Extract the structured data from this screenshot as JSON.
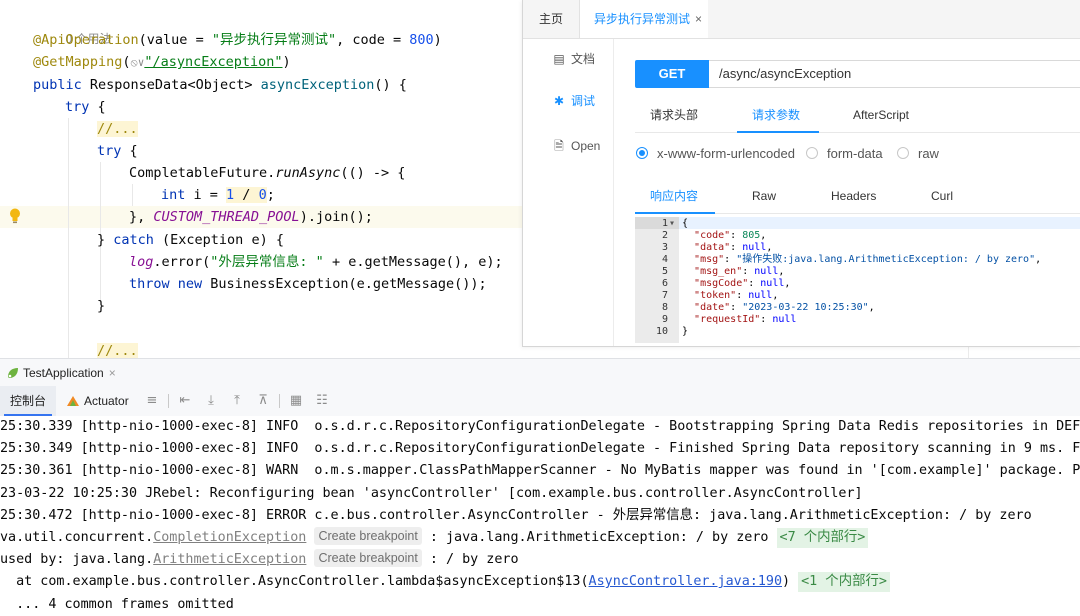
{
  "editor": {
    "usages": "0 个用法",
    "line_api_op": {
      "ann": "@ApiOperation",
      "p1": "(value = ",
      "str": "\"异步执行异常测试\"",
      "p2": ", code = ",
      "num": "800",
      "p3": ")"
    },
    "line_get_mapping": {
      "ann": "@GetMapping",
      "p1": "(",
      "icon": "⦸∨",
      "str": "\"/asyncException\"",
      "p2": ")"
    },
    "line_signature": {
      "kw": "public",
      "p1": " ResponseData<Object> ",
      "fn": "asyncException",
      "p2": "() {"
    },
    "line_try1": {
      "kw": "try",
      "p1": " {"
    },
    "line_fold1": "//...",
    "line_try2": {
      "kw": "try",
      "p1": " {"
    },
    "line_run_async": {
      "p1": "CompletableFuture.",
      "fn": "runAsync",
      "p2": "(() -> {"
    },
    "line_div": {
      "kw": "int",
      "p1": " i = ",
      "n1": "1",
      "p2": " / ",
      "n2": "0",
      "p3": ";"
    },
    "line_pool": {
      "p1": "}, ",
      "const": "CUSTOM_THREAD_POOL",
      "p2": ").join();"
    },
    "line_catch": {
      "p1": "} ",
      "kw": "catch",
      "p2": " (Exception e) {"
    },
    "line_log": {
      "field": "log",
      "p1": ".error(",
      "str": "\"外层异常信息: \"",
      "p2": " + e.getMessage(), e);"
    },
    "line_throw": {
      "kw1": "throw",
      "kw2": "new",
      "p1": " BusinessException(e.getMessage());"
    },
    "line_close": "}",
    "line_fold2": "//..."
  },
  "api_panel": {
    "tabs": {
      "home": "主页",
      "active": "异步执行异常测试",
      "close": "×"
    },
    "sidebar": [
      {
        "icon": "▤",
        "label": "文档"
      },
      {
        "icon": "✱",
        "label": "调试"
      },
      {
        "icon": "🗎",
        "label": "Open"
      }
    ],
    "method": "GET",
    "url": "/async/asyncException",
    "request_tabs": [
      "请求头部",
      "请求参数",
      "AfterScript"
    ],
    "active_request_tab": "请求参数",
    "body_types": [
      "x-www-form-urlencoded",
      "form-data",
      "raw"
    ],
    "selected_body_type": "x-www-form-urlencoded",
    "response_tabs": [
      "响应内容",
      "Raw",
      "Headers",
      "Curl"
    ],
    "active_response_tab": "响应内容",
    "response": {
      "line_numbers": [
        "1",
        "2",
        "3",
        "4",
        "5",
        "6",
        "7",
        "8",
        "9",
        "10"
      ],
      "fold_marker": "▾",
      "open_brace": "{",
      "close_brace": "}",
      "entries": [
        {
          "key": "\"code\"",
          "value": "805"
        },
        {
          "key": "\"data\"",
          "value": "null"
        },
        {
          "key": "\"msg\"",
          "value": "\"操作失败:java.lang.ArithmeticException: / by zero\""
        },
        {
          "key": "\"msg_en\"",
          "value": "null"
        },
        {
          "key": "\"msgCode\"",
          "value": "null"
        },
        {
          "key": "\"token\"",
          "value": "null"
        },
        {
          "key": "\"date\"",
          "value": "\"2023-03-22 10:25:30\""
        },
        {
          "key": "\"requestId\"",
          "value": "null"
        }
      ]
    }
  },
  "run_window": {
    "title": "TestApplication",
    "close": "×",
    "tabs": [
      "控制台",
      "Actuator"
    ],
    "toolbar_icons": [
      "menu-icon",
      "scroll-end-icon",
      "download-icon",
      "upload-icon",
      "filter-icon",
      "table-icon",
      "tree-icon"
    ]
  },
  "console": {
    "lines": [
      "25:30.339 [http-nio-1000-exec-8] INFO  o.s.d.r.c.RepositoryConfigurationDelegate - Bootstrapping Spring Data Redis repositories in DEF",
      "25:30.349 [http-nio-1000-exec-8] INFO  o.s.d.r.c.RepositoryConfigurationDelegate - Finished Spring Data repository scanning in 9 ms. F",
      "25:30.361 [http-nio-1000-exec-8] WARN  o.m.s.mapper.ClassPathMapperScanner - No MyBatis mapper was found in '[com.example]' package. P",
      "23-03-22 10:25:30 JRebel: Reconfiguring bean 'asyncController' [com.example.bus.controller.AsyncController]",
      "25:30.472 [http-nio-1000-exec-8] ERROR c.e.bus.controller.AsyncController - 外层异常信息: java.lang.ArithmeticException: / by zero"
    ],
    "line6": {
      "prefix": "va.util.concurrent.",
      "link": "CompletionException",
      "bp": "Create breakpoint",
      "rest": " : java.lang.ArithmeticException: / by zero ",
      "badge": "<7 个内部行>"
    },
    "line7": {
      "prefix": "used by: java.lang.",
      "link": "ArithmeticException",
      "bp": "Create breakpoint",
      "rest": " : / by zero"
    },
    "line8": {
      "prefix": "  at com.example.bus.controller.AsyncController.lambda$asyncException$13(",
      "link": "AsyncController.java:190",
      "suffix": ") ",
      "badge": "<1 个内部行>"
    },
    "line9": "  ... 4 common frames omitted"
  },
  "colors": {
    "accent": "#1890ff",
    "ide_blue": "#3574f0",
    "bulb": "#f2b711"
  }
}
